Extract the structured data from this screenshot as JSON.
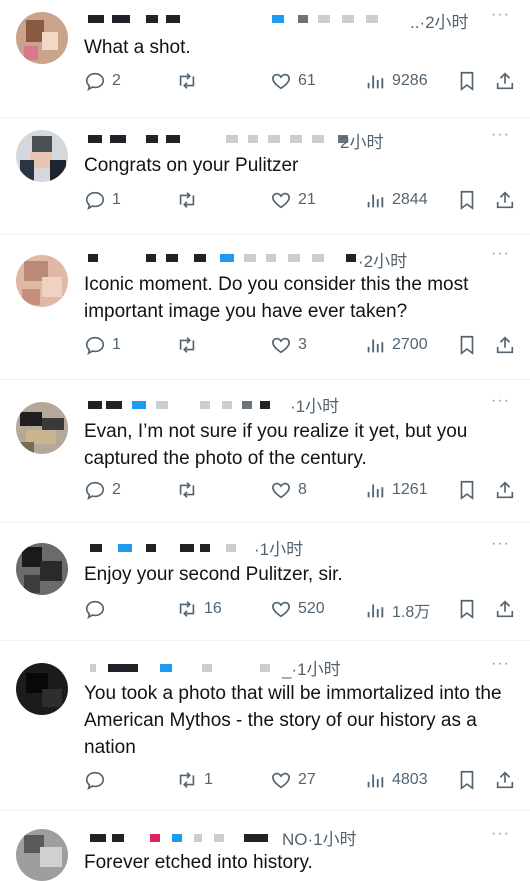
{
  "more_label": "···",
  "replies": [
    {
      "time": "..·2小时",
      "text": "What a shot.",
      "reply": "2",
      "retweet": "",
      "like": "61",
      "views": "9286"
    },
    {
      "time": "2小时",
      "text": "Congrats on your Pulitzer",
      "reply": "1",
      "retweet": "",
      "like": "21",
      "views": "2844"
    },
    {
      "time": "·2小时",
      "text": "Iconic moment. Do you consider this the most important image you have ever taken?",
      "reply": "1",
      "retweet": "",
      "like": "3",
      "views": "2700"
    },
    {
      "time": "·1小时",
      "text": "Evan, I’m not sure if you realize it yet, but you captured the photo of the century.",
      "reply": "2",
      "retweet": "",
      "like": "8",
      "views": "1261"
    },
    {
      "time": "·1小时",
      "text": "Enjoy your second Pulitzer, sir.",
      "reply": "",
      "retweet": "16",
      "like": "520",
      "views": "1.8万"
    },
    {
      "time": "_·1小时",
      "text": "You took a photo that will be immortalized into the American Mythos - the story of our history as a nation",
      "reply": "",
      "retweet": "1",
      "like": "27",
      "views": "4803"
    },
    {
      "time": "NO·1小时",
      "text": "Forever etched into history."
    }
  ]
}
